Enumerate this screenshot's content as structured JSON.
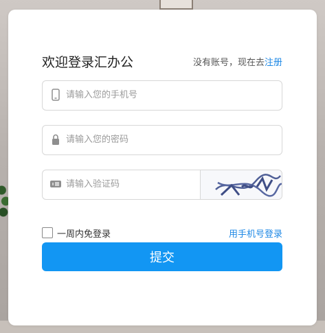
{
  "title": "欢迎登录汇办公",
  "register": {
    "prompt": "没有账号，现在去",
    "link": "注册"
  },
  "fields": {
    "phone": {
      "placeholder": "请输入您的手机号",
      "icon": "mobile-phone-icon"
    },
    "password": {
      "placeholder": "请输入您的密码",
      "icon": "lock-icon"
    },
    "captcha": {
      "placeholder": "请输入验证码",
      "icon": "captcha-icon",
      "captcha_text": "3U24"
    }
  },
  "options": {
    "remember": "一周内免登录",
    "phone_login": "用手机号登录"
  },
  "submit": "提交",
  "colors": {
    "accent": "#1296f3",
    "link": "#1e88e5"
  }
}
